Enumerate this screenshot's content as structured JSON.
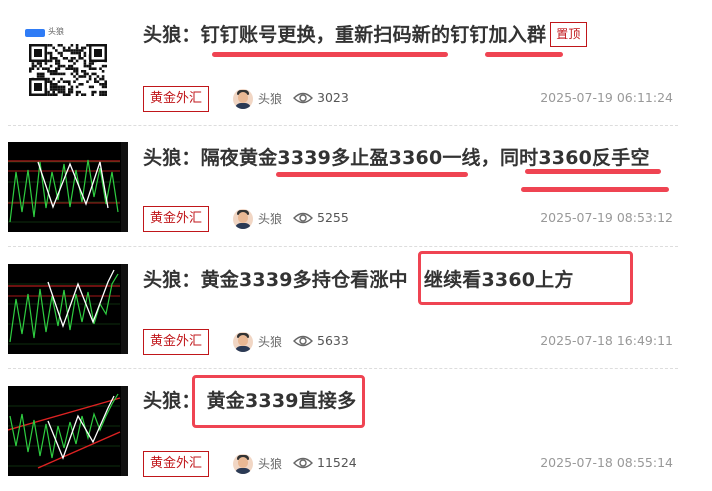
{
  "articles": [
    {
      "title": "头狼：钉钉账号更换，重新扫码新的钉钉加入群",
      "pin_label": "置顶",
      "category": "黄金外汇",
      "author": "头狼",
      "views": "3023",
      "date": "2025-07-19 06:11:24",
      "thumb_label": "头狼"
    },
    {
      "title": "头狼：隔夜黄金3339多止盈3360一线，同时3360反手空",
      "category": "黄金外汇",
      "author": "头狼",
      "views": "5255",
      "date": "2025-07-19 08:53:12"
    },
    {
      "title": "头狼：黄金3339多持仓看涨中",
      "title_extra": "继续看3360上方",
      "category": "黄金外汇",
      "author": "头狼",
      "views": "5633",
      "date": "2025-07-18 16:49:11"
    },
    {
      "title_prefix": "头狼：",
      "title": "黄金3339直接多",
      "category": "黄金外汇",
      "author": "头狼",
      "views": "11524",
      "date": "2025-07-18 08:55:14"
    }
  ],
  "colors": {
    "accent_red": "#c0161a",
    "annotation_red": "#ef4452",
    "title_text": "#333333",
    "date_text": "#999999"
  },
  "icons": [
    "qr-code-icon",
    "eye-icon",
    "author-avatar"
  ]
}
